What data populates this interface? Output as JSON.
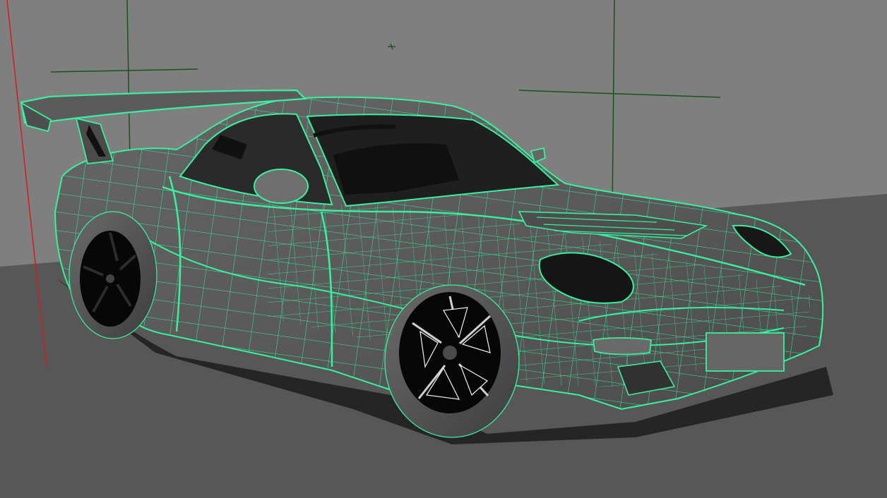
{
  "viewport": {
    "mode": "wireframe-on-shaded",
    "colors": {
      "background_upper": "#7f7f7f",
      "background_lower": "#575757",
      "wireframe": "#38f0a0",
      "body_shade": "#5b5b5b",
      "tire": "#4f4f4f",
      "rim": "#070707",
      "grid_line": "#17531e",
      "axis_line": "#d21d1d"
    }
  }
}
